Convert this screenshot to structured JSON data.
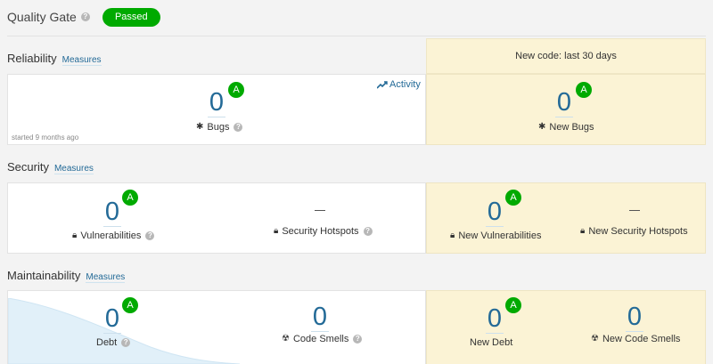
{
  "quality_gate": {
    "title": "Quality Gate",
    "status": "Passed"
  },
  "new_code_period": "New code: last 30 days",
  "reliability": {
    "title": "Reliability",
    "measures_link": "Measures",
    "activity_link": "Activity",
    "started": "started 9 months ago",
    "bugs": {
      "value": "0",
      "rating": "A",
      "label": "Bugs"
    },
    "new_bugs": {
      "value": "0",
      "rating": "A",
      "label": "New Bugs"
    }
  },
  "security": {
    "title": "Security",
    "measures_link": "Measures",
    "vulnerabilities": {
      "value": "0",
      "rating": "A",
      "label": "Vulnerabilities"
    },
    "hotspots": {
      "value": "—",
      "label": "Security Hotspots"
    },
    "new_vulnerabilities": {
      "value": "0",
      "rating": "A",
      "label": "New Vulnerabilities"
    },
    "new_hotspots": {
      "value": "—",
      "label": "New Security Hotspots"
    }
  },
  "maintainability": {
    "title": "Maintainability",
    "measures_link": "Measures",
    "debt": {
      "value": "0",
      "rating": "A",
      "label": "Debt"
    },
    "code_smells": {
      "value": "0",
      "label": "Code Smells"
    },
    "new_debt": {
      "value": "0",
      "rating": "A",
      "label": "New Debt"
    },
    "new_code_smells": {
      "value": "0",
      "label": "New Code Smells"
    }
  },
  "icons": [
    "help-icon",
    "bug-icon",
    "lock-icon",
    "code-smell-icon",
    "activity-icon"
  ],
  "colors": {
    "rating_a": "#00aa00",
    "link": "#236a97",
    "new_code_bg": "#fbf3d5",
    "area_fill": "#e1f0f9"
  }
}
